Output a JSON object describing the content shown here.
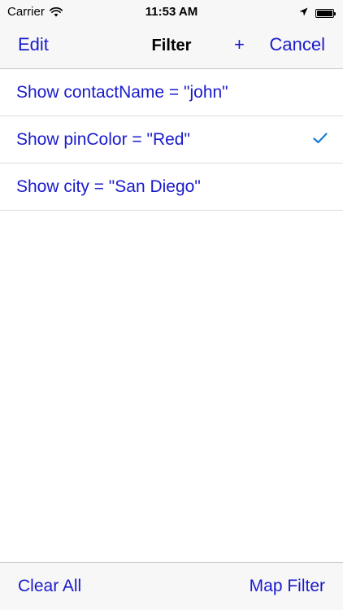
{
  "status_bar": {
    "carrier": "Carrier",
    "time": "11:53 AM",
    "icons": [
      "wifi-icon",
      "location-arrow-icon",
      "battery-icon"
    ]
  },
  "nav_bar": {
    "left_button": "Edit",
    "title": "Filter",
    "add_button": "+",
    "right_button": "Cancel"
  },
  "filters": [
    {
      "label": "Show contactName = \"john\"",
      "checked": false
    },
    {
      "label": "Show pinColor = \"Red\"",
      "checked": true
    },
    {
      "label": "Show city = \"San Diego\"",
      "checked": false
    }
  ],
  "toolbar": {
    "clear_all": "Clear All",
    "map_filter": "Map Filter"
  },
  "colors": {
    "tint": "#1a1acc",
    "checkmark": "#1a7bd6",
    "bar_background": "#f7f7f7",
    "separator": "#c8c7cc"
  }
}
